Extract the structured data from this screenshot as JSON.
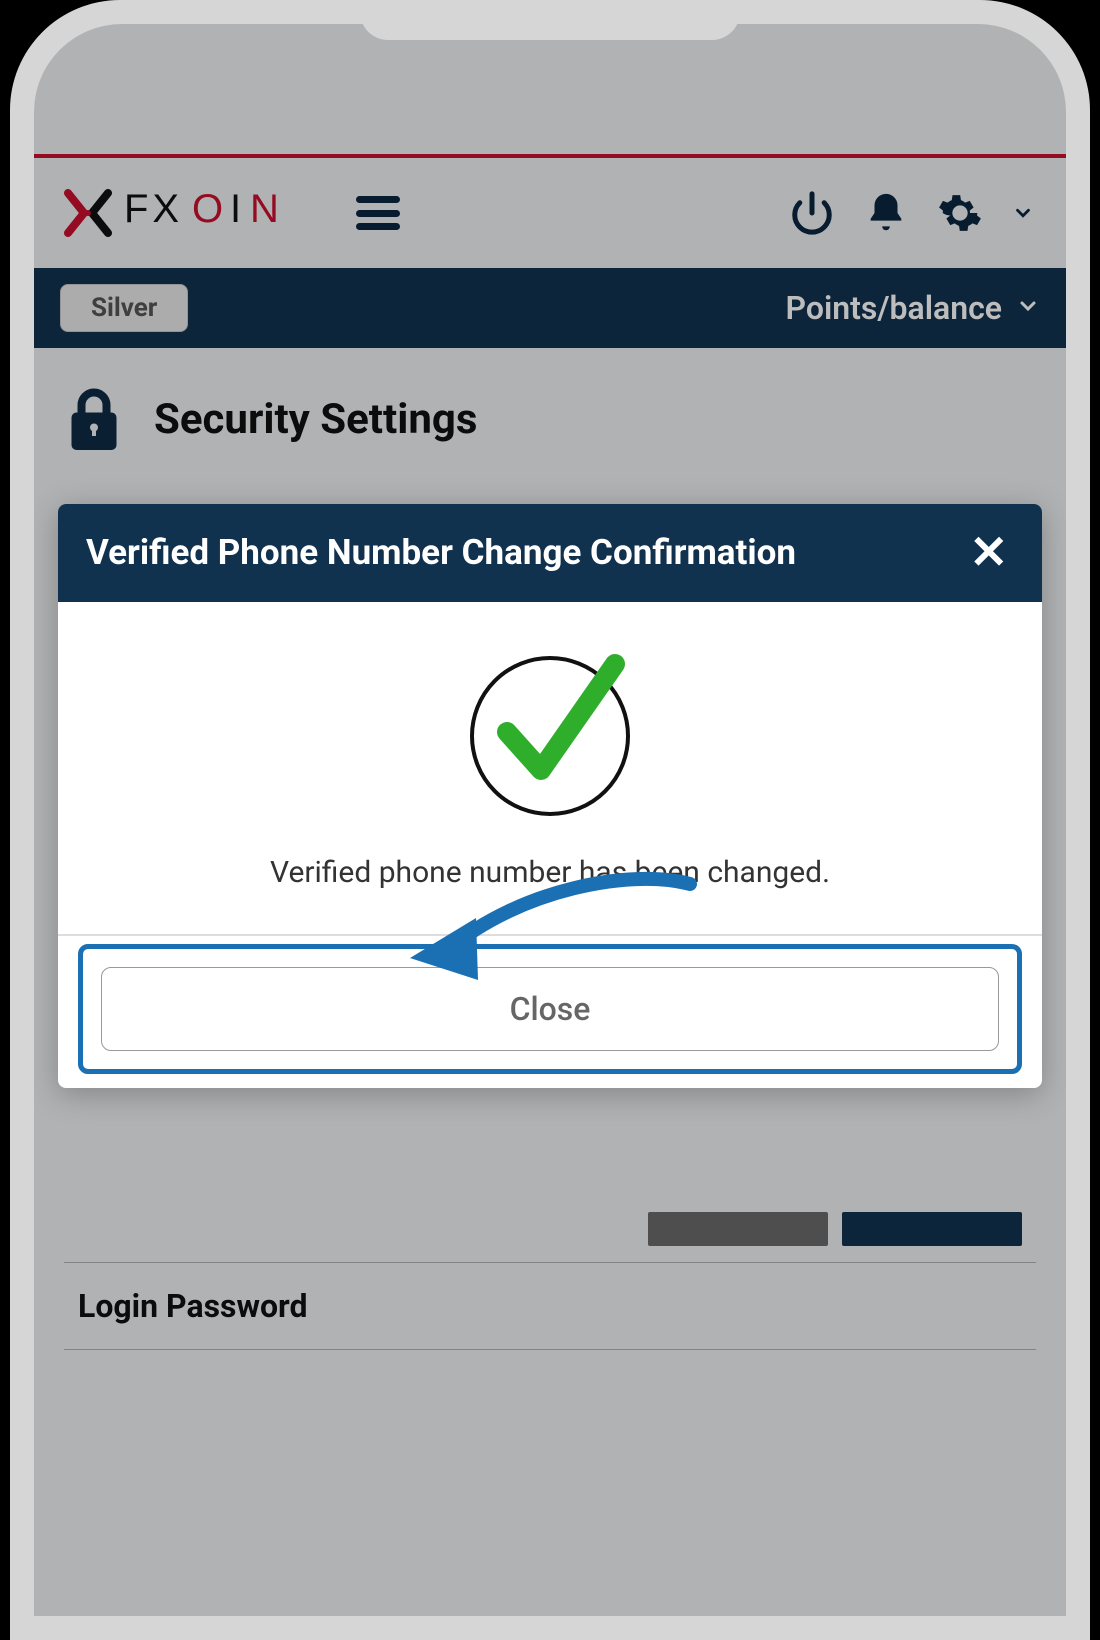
{
  "header": {
    "logo_text": "FXON",
    "menu_label": "menu"
  },
  "account_bar": {
    "badge": "Silver",
    "points_label": "Points/balance"
  },
  "page": {
    "title": "Security Settings",
    "login_password_label": "Login Password"
  },
  "modal": {
    "title": "Verified Phone Number Change Confirmation",
    "message": "Verified phone number has been changed.",
    "close_button": "Close"
  },
  "colors": {
    "navy": "#11324f",
    "red": "#c8102e",
    "green": "#2fae2c",
    "highlight_blue": "#1b6fb3"
  }
}
